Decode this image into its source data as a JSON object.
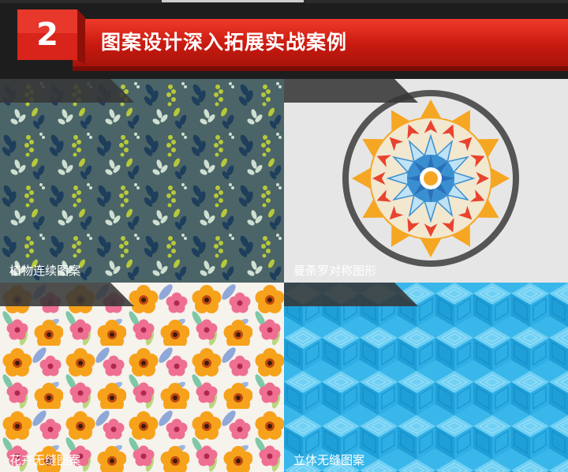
{
  "section": {
    "number": "2",
    "title": "图案设计深入拓展实战案例"
  },
  "tiles": [
    {
      "caption": "植物连续图案"
    },
    {
      "caption": "曼荼罗对称图形"
    },
    {
      "caption": "花卉无缝图案"
    },
    {
      "caption": "立体无缝图案"
    }
  ],
  "colors": {
    "banner_red": "#d9231a",
    "botanical_bg": "#4b6467",
    "mandala_orange": "#f5a623",
    "mandala_red": "#e8432e",
    "mandala_blue": "#3a8fd0",
    "geometric_blue": "#39b7ea"
  }
}
